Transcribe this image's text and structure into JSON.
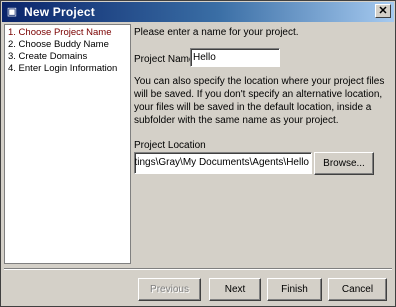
{
  "window": {
    "title": "New Project",
    "icon": "window-menu-icon",
    "close_glyph": "✕"
  },
  "steps": [
    {
      "label": "1. Choose Project Name",
      "active": true
    },
    {
      "label": "2. Choose Buddy Name",
      "active": false
    },
    {
      "label": "3. Create Domains",
      "active": false
    },
    {
      "label": "4. Enter Login Information",
      "active": false
    }
  ],
  "content": {
    "prompt": "Please enter a name for your project.",
    "project_name_label": "Project Name",
    "project_name_value": "Hello",
    "info_text": "You can also specify the location where your project files will be saved. If you don't specify an alternative location, your files will be saved in the default location, inside a subfolder with the same name as your project.",
    "project_location_label": "Project Location",
    "project_location_value": "ttings\\Gray\\My Documents\\Agents\\Hello",
    "browse_label": "Browse..."
  },
  "buttons": {
    "previous": "Previous",
    "next": "Next",
    "finish": "Finish",
    "cancel": "Cancel"
  },
  "colors": {
    "active_step": "#7a0000",
    "title_bar_start": "#0a246a",
    "title_bar_end": "#a6caf0",
    "dialog_face": "#d4d0c8"
  }
}
